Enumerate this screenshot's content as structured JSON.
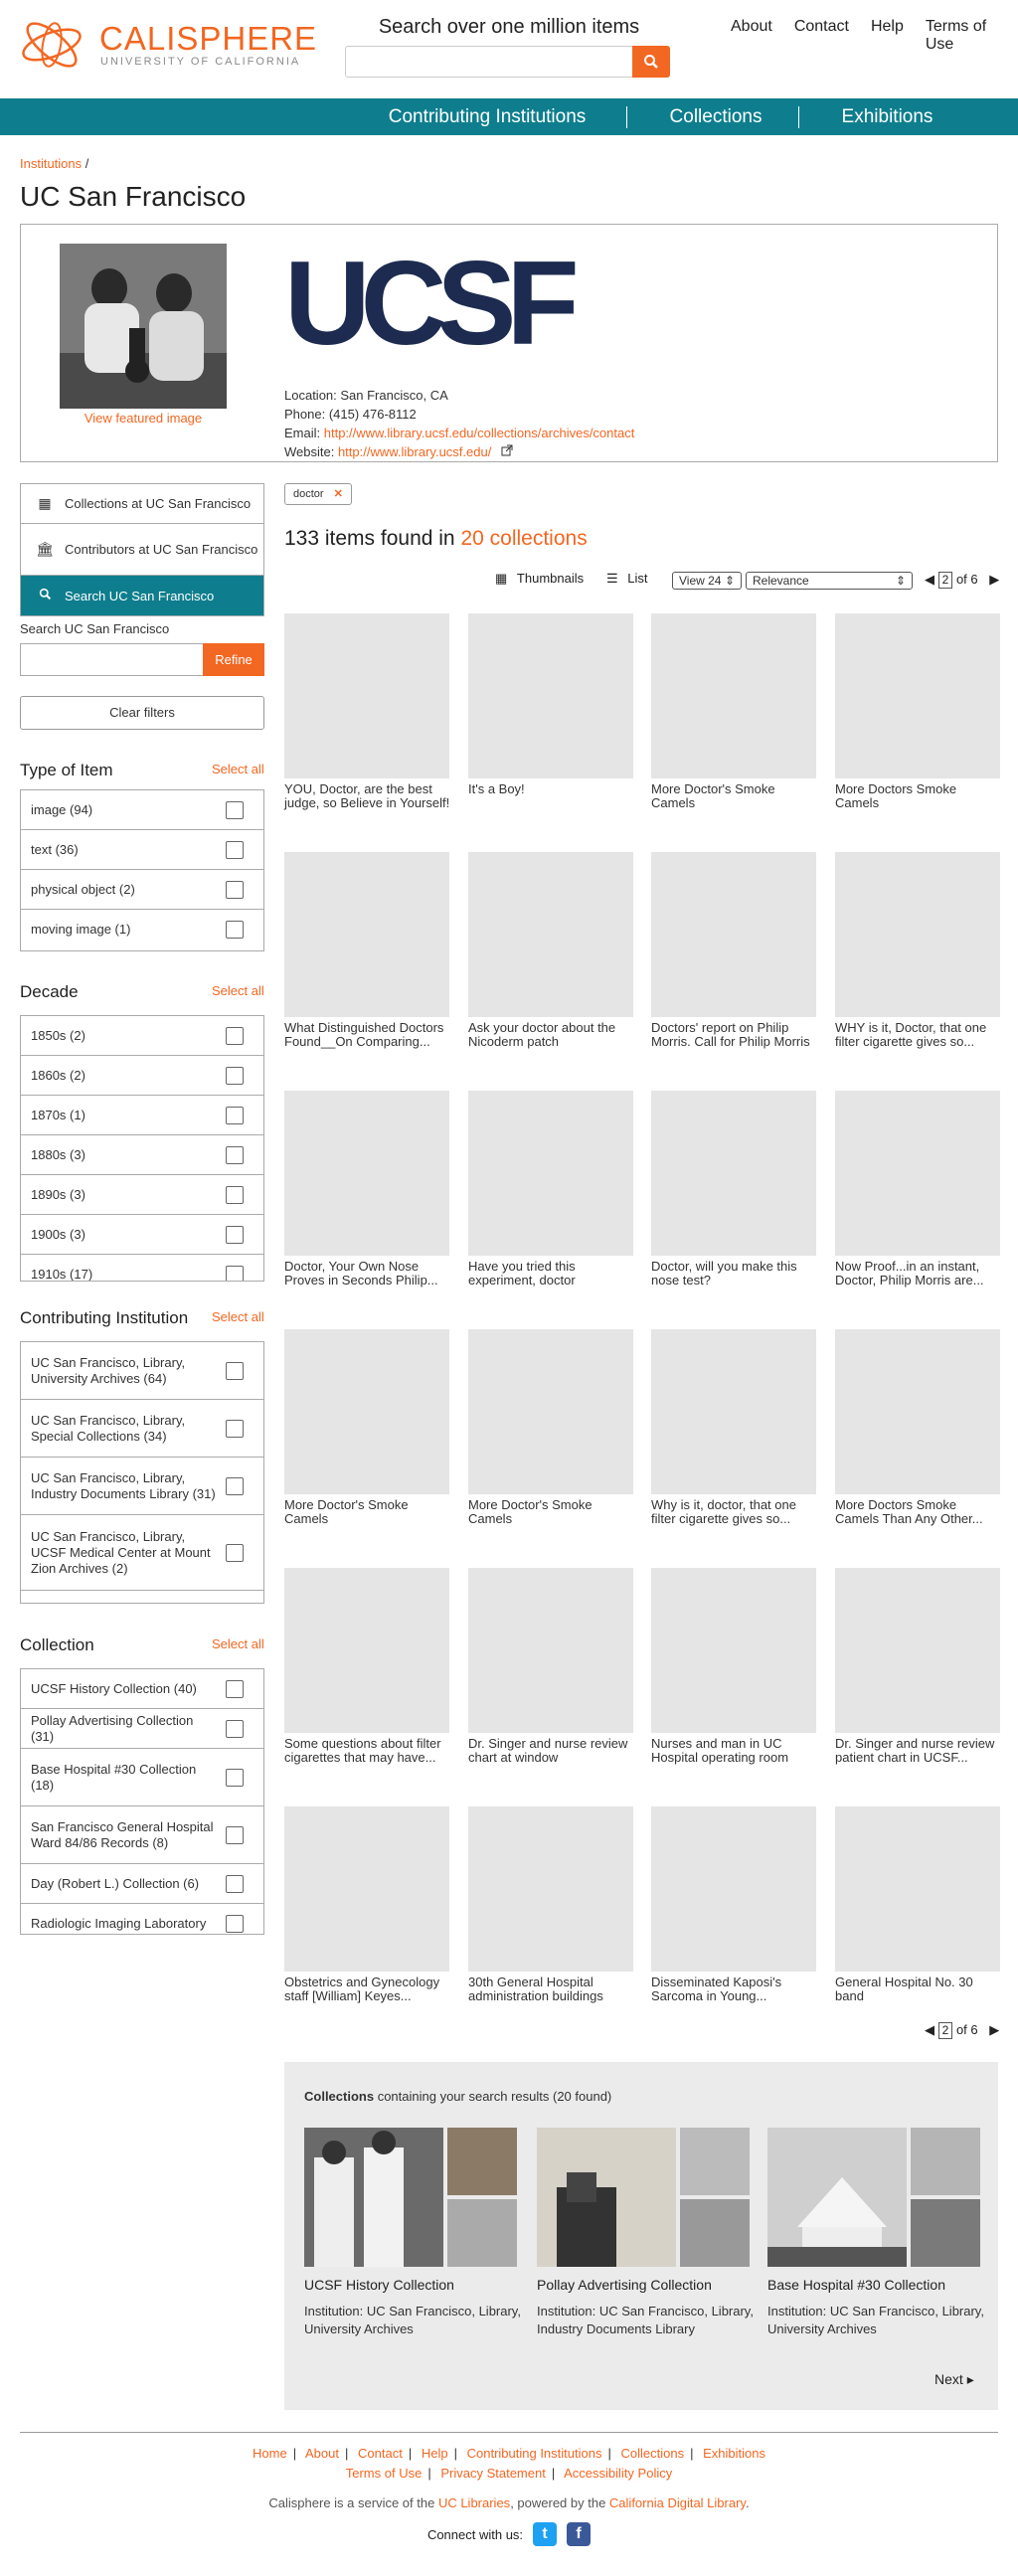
{
  "brand": {
    "name": "CALISPHERE",
    "sub": "UNIVERSITY OF CALIFORNIA",
    "accent": "#f26722",
    "teal": "#0e7e8e"
  },
  "header": {
    "search_title": "Search over one million items",
    "search_placeholder": "",
    "search_icon": "search-icon"
  },
  "topnav": [
    "About",
    "Contact",
    "Help",
    "Terms of Use"
  ],
  "mainnav": [
    "Contributing Institutions",
    "Collections",
    "Exhibitions"
  ],
  "breadcrumb": {
    "link": "Institutions",
    "sep": "/"
  },
  "page_title": "UC San Francisco",
  "institution": {
    "featured_link": "View featured image",
    "logo_text": "UCSF",
    "location": "Location: San Francisco, CA",
    "phone": "Phone: (415) 476-8112",
    "email_label": "Email: ",
    "email": "http://www.library.ucsf.edu/collections/archives/contact",
    "website_label": "Website: ",
    "website": "http://www.library.ucsf.edu/"
  },
  "sidenav": [
    {
      "icon": "grid-icon",
      "label": "Collections at UC San Francisco"
    },
    {
      "icon": "institution-icon",
      "label": "Contributors at UC San Francisco"
    },
    {
      "icon": "search-icon",
      "label": "Search UC San Francisco"
    }
  ],
  "sidesearch": {
    "label": "Search UC San Francisco",
    "refine": "Refine",
    "clear": "Clear filters"
  },
  "facets": {
    "select_all": "Select all",
    "type": {
      "title": "Type of Item",
      "items": [
        "image (94)",
        "text (36)",
        "physical object (2)",
        "moving image (1)"
      ]
    },
    "decade": {
      "title": "Decade",
      "items": [
        "1850s (2)",
        "1860s (2)",
        "1870s (1)",
        "1880s (3)",
        "1890s (3)",
        "1900s (3)",
        "1910s (17)"
      ]
    },
    "institution": {
      "title": "Contributing Institution",
      "items": [
        "UC San Francisco, Library, University Archives (64)",
        "UC San Francisco, Library, Special Collections (34)",
        "UC San Francisco, Library, Industry Documents Library (31)",
        "UC San Francisco, Library, UCSF Medical Center at Mount Zion Archives (2)"
      ]
    },
    "collection": {
      "title": "Collection",
      "items": [
        "UCSF History Collection (40)",
        "Pollay Advertising Collection (31)",
        "Base Hospital #30 Collection (18)",
        "San Francisco General Hospital Ward 84/86 Records (8)",
        "Day (Robert L.) Collection (6)",
        "Radiologic Imaging Laboratory"
      ]
    }
  },
  "results": {
    "filter_pill": "doctor",
    "count_text": "133 items found in ",
    "collections_link": "20 collections",
    "view_thumbnails": "Thumbnails",
    "view_list": "List",
    "per_page": "View 24",
    "sort": "Relevance",
    "page": "2",
    "page_of": "of 6",
    "items": [
      "YOU, Doctor, are the best judge, so Believe in Yourself!",
      "It's a Boy!",
      "More Doctor's Smoke Camels",
      "More Doctors Smoke Camels",
      "What Distinguished Doctors Found__On Comparing...",
      "Ask your doctor about the Nicoderm patch",
      "Doctors' report on Philip Morris. Call for Philip Morris",
      "WHY is it, Doctor, that one filter cigarette gives so...",
      "Doctor, Your Own Nose Proves in Seconds Philip...",
      "Have you tried this experiment, doctor",
      "Doctor, will you make this nose test?",
      "Now Proof...in an instant, Doctor, Philip Morris are...",
      "More Doctor's Smoke Camels",
      "More Doctor's Smoke Camels",
      "Why is it, doctor, that one filter cigarette gives so...",
      "More Doctors Smoke Camels Than Any Other...",
      "Some questions about filter cigarettes that may have...",
      "Dr. Singer and nurse review chart at window",
      "Nurses and man in UC Hospital operating room",
      "Dr. Singer and nurse review patient chart in UCSF...",
      "Obstetrics and Gynecology staff [William] Keyes...",
      "30th General Hospital administration buildings",
      "Disseminated Kaposi's Sarcoma in Young...",
      "General Hospital No. 30 band"
    ]
  },
  "collections_panel": {
    "heading_bold": "Collections",
    "heading_rest": " containing your search results (20 found)",
    "cards": [
      {
        "name": "UCSF History Collection",
        "institution": "Institution: UC San Francisco, Library, University Archives"
      },
      {
        "name": "Pollay Advertising Collection",
        "institution": "Institution: UC San Francisco, Library, Industry Documents Library"
      },
      {
        "name": "Base Hospital #30 Collection",
        "institution": "Institution: UC San Francisco, Library, University Archives"
      }
    ],
    "next": "Next"
  },
  "footer": {
    "row1": [
      "Home",
      "About",
      "Contact",
      "Help",
      "Contributing Institutions",
      "Collections",
      "Exhibitions"
    ],
    "row2": [
      "Terms of Use",
      "Privacy Statement",
      "Accessibility Policy"
    ],
    "note_a": "Calisphere is a service of the ",
    "note_link1": "UC Libraries",
    "note_b": ", powered by the ",
    "note_link2": "California Digital Library",
    "note_c": ".",
    "connect": "Connect with us:"
  }
}
